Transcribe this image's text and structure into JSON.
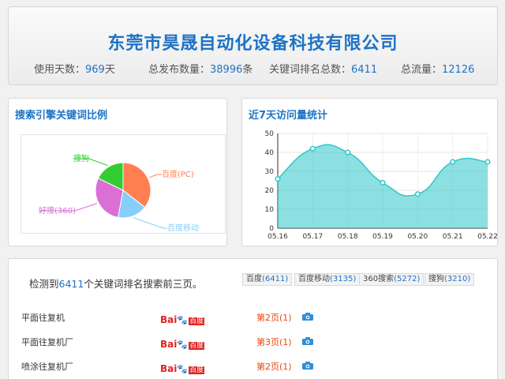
{
  "header": {
    "company": "东莞市昊晟自动化设备科技有限公司",
    "stats": [
      {
        "label": "使用天数：",
        "value": "969",
        "unit": "天"
      },
      {
        "label": "总发布数量：",
        "value": "38996",
        "unit": "条"
      },
      {
        "label": "关键词排名总数：",
        "value": "6411",
        "unit": ""
      },
      {
        "label": "总流量：",
        "value": "12126",
        "unit": ""
      }
    ]
  },
  "pie_panel": {
    "title": "搜索引擎关键词比例"
  },
  "line_panel": {
    "title": "近7天访问量统计"
  },
  "chart_data": [
    {
      "type": "pie",
      "categories": [
        "百度(PC)",
        "百度移动",
        "好搜(360)",
        "搜狗"
      ],
      "values": [
        6411,
        3135,
        5272,
        3210
      ],
      "colors": [
        "#ff7f50",
        "#87cefa",
        "#da70d6",
        "#32cd32"
      ]
    },
    {
      "type": "area",
      "categories": [
        "05.16",
        "05.17",
        "05.18",
        "05.19",
        "05.20",
        "05.21",
        "05.22"
      ],
      "values": [
        26,
        42,
        40,
        24,
        18,
        35,
        35
      ],
      "ylim": [
        0,
        50
      ],
      "yticks": [
        0,
        10,
        20,
        30,
        40,
        50
      ],
      "color": "#2ec7c9"
    }
  ],
  "ranking": {
    "prefix": "检测到",
    "count": "6411",
    "suffix": "个关键词排名搜索前三页。",
    "engines": [
      {
        "name": "百度",
        "count": "(6411)"
      },
      {
        "name": "百度移动",
        "count": "(3135)"
      },
      {
        "name": "360搜索",
        "count": "(5272)"
      },
      {
        "name": "搜狗",
        "count": "(3210)"
      }
    ],
    "rows": [
      {
        "keyword": "平面往复机",
        "rank": "第2页(1)"
      },
      {
        "keyword": "平面往复机厂",
        "rank": "第3页(1)"
      },
      {
        "keyword": "喷涂往复机厂",
        "rank": "第2页(1)"
      }
    ],
    "logo": {
      "part1": "Bai",
      "part2": "百度"
    }
  }
}
